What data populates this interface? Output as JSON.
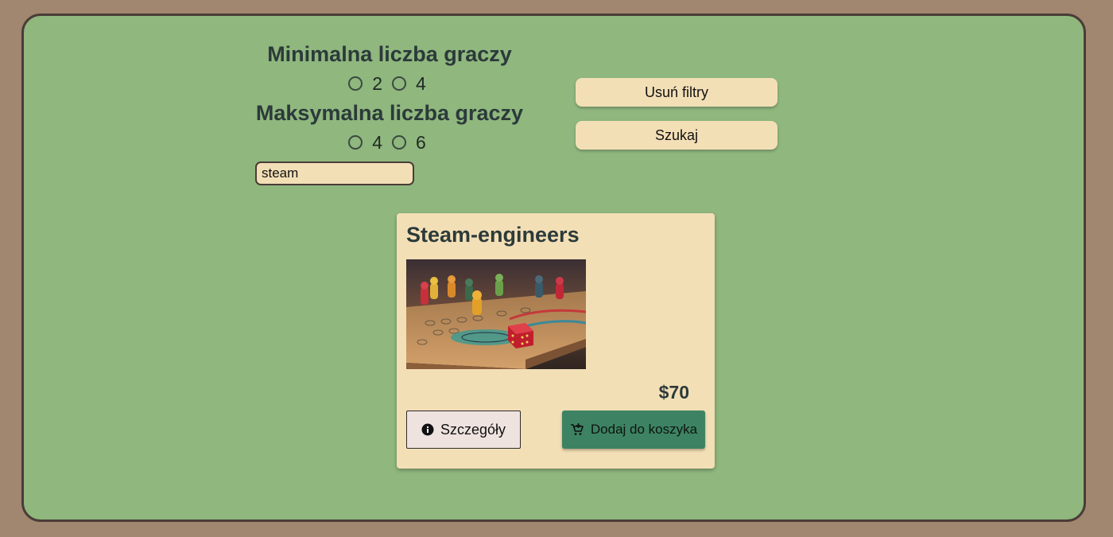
{
  "filters": {
    "min_players": {
      "heading": "Minimalna liczba graczy",
      "options": [
        "2",
        "4"
      ]
    },
    "max_players": {
      "heading": "Maksymalna liczba graczy",
      "options": [
        "4",
        "6"
      ]
    },
    "search": {
      "value": "steam"
    },
    "clear_label": "Usuń filtry",
    "search_label": "Szukaj"
  },
  "results": [
    {
      "title": "Steam-engineers",
      "image_icon": "board-game-photo",
      "price": "$70",
      "details_label": "Szczegóły",
      "details_icon": "info-icon",
      "cart_label": "Dodaj do koszyka",
      "cart_icon": "add-cart-icon"
    }
  ],
  "colors": {
    "page_background": "#a18670",
    "panel_background": "#8fb77e",
    "card_background": "#f3dfb6",
    "cart_button": "#3d8363",
    "heading_text": "#2c3a3a"
  }
}
